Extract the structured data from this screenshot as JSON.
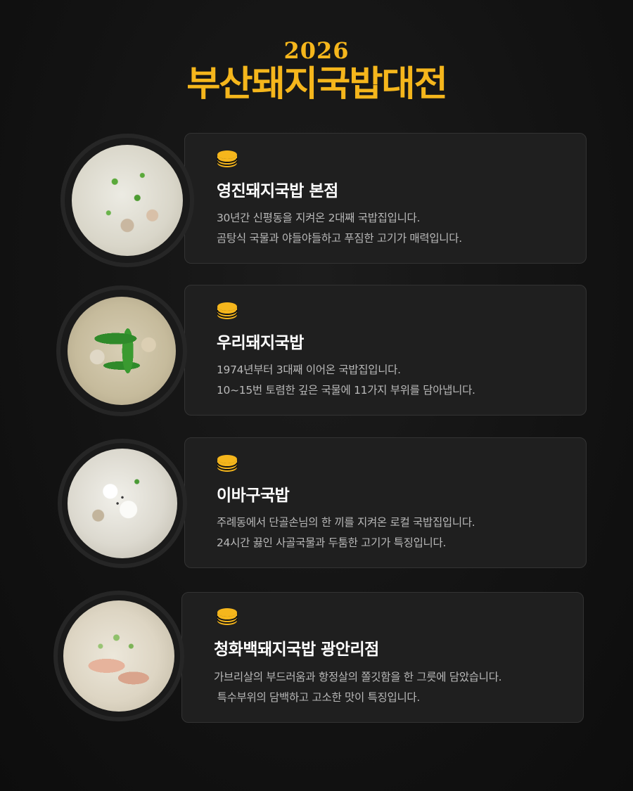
{
  "header": {
    "year": "2026",
    "title": "부산돼지국밥대전"
  },
  "colors": {
    "accent": "#f5b61c",
    "background": "#131313",
    "card": "#1f1f1f",
    "card_border": "#333333",
    "description_text": "#b9b9b9"
  },
  "stores": [
    {
      "name": "영진돼지국밥 본점",
      "icon": "gukbap-bowl-icon",
      "lines": [
        "30년간 신평동을 지켜온 2대째 국밥집입니다.",
        "곰탕식 국물과 야들야들하고 푸짐한 고기가 매력입니다."
      ]
    },
    {
      "name": "우리돼지국밥",
      "icon": "gukbap-bowl-icon",
      "lines": [
        "1974년부터 3대째 이어온 국밥집입니다.",
        "10~15번 토렴한 깊은 국물에 11가지 부위를 담아냅니다."
      ]
    },
    {
      "name": "이바구국밥",
      "icon": "gukbap-bowl-icon",
      "lines": [
        "주례동에서 단골손님의 한 끼를 지켜온 로컬 국밥집입니다.",
        "24시간 끓인 사골국물과 두툼한 고기가 특징입니다."
      ]
    },
    {
      "name": "청화백돼지국밥 광안리점",
      "icon": "gukbap-bowl-icon",
      "lines": [
        "가브리살의 부드러움과 항정살의 쫄깃함을 한 그릇에 담았습니다.",
        " 특수부위의 담백하고 고소한 맛이 특징입니다."
      ]
    }
  ]
}
